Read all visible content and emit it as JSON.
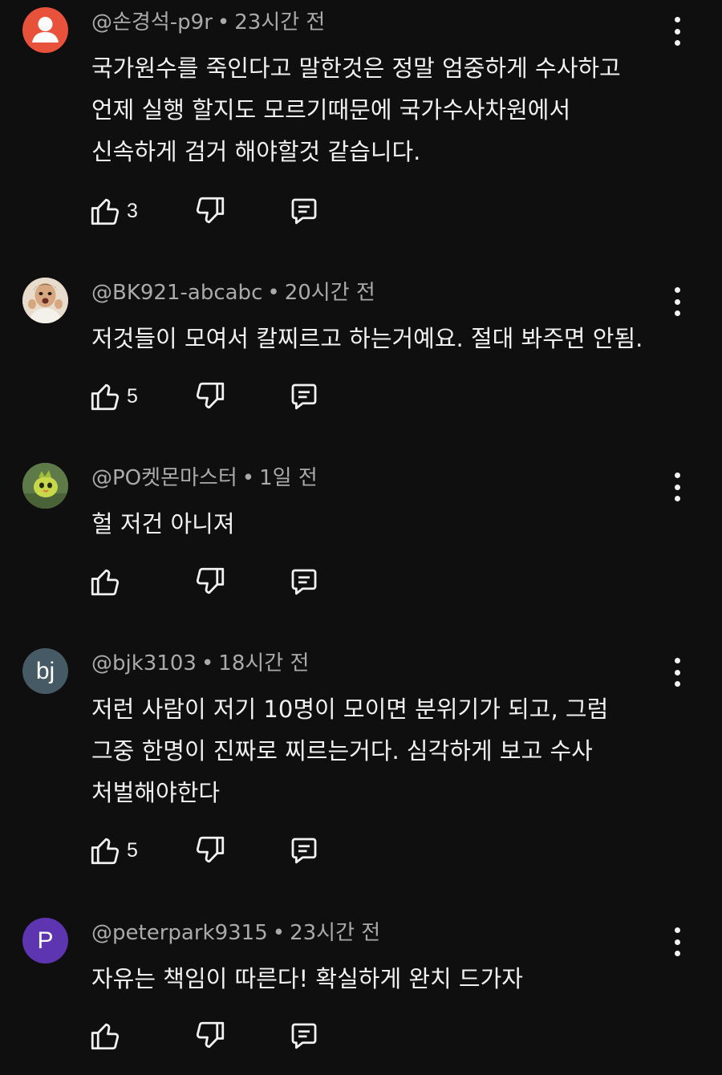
{
  "comments": [
    {
      "author": "@손경석-p9r",
      "time": "23시간 전",
      "avatar": {
        "type": "default",
        "bg": "#e8523a",
        "letter": ""
      },
      "lines": [
        "국가원수를 죽인다고 말한것은 정말 엄중하게 수사하고",
        "언제 실행 할지도 모르기때문에 국가수사차원에서",
        "신속하게 검거 해야할것 같습니다."
      ],
      "likes": "3"
    },
    {
      "author": "@BK921-abcabc",
      "time": "20시간 전",
      "avatar": {
        "type": "photo-person",
        "bg": "#d9c3ae",
        "letter": ""
      },
      "lines": [
        "저것들이 모여서 칼찌르고 하는거예요. 절대 봐주면 안됨."
      ],
      "likes": "5"
    },
    {
      "author": "@PO켓몬마스터",
      "time": "1일 전",
      "avatar": {
        "type": "photo-creature",
        "bg": "#6f8a54",
        "letter": ""
      },
      "lines": [
        "헐 저건 아니져"
      ],
      "likes": ""
    },
    {
      "author": "@bjk3103",
      "time": "18시간 전",
      "avatar": {
        "type": "letter",
        "bg": "#455a64",
        "letter": "bj"
      },
      "lines": [
        "저런 사람이 저기 10명이 모이면 분위기가 되고, 그럼",
        "그중 한명이 진짜로 찌르는거다. 심각하게 보고 수사",
        "처벌해야한다"
      ],
      "likes": "5"
    },
    {
      "author": "@peterpark9315",
      "time": "23시간 전",
      "avatar": {
        "type": "letter",
        "bg": "#5e35b1",
        "letter": "P"
      },
      "lines": [
        "자유는 책임이 따른다! 확실하게 완치 드가자"
      ],
      "likes": ""
    }
  ],
  "icons": {
    "like": "thumb-up-icon",
    "dislike": "thumb-down-icon",
    "reply": "reply-icon",
    "more": "more-vertical-icon"
  },
  "colors": {
    "background": "#0f0f0f",
    "text": "#f1f1f1",
    "meta": "#aaaaaa"
  }
}
